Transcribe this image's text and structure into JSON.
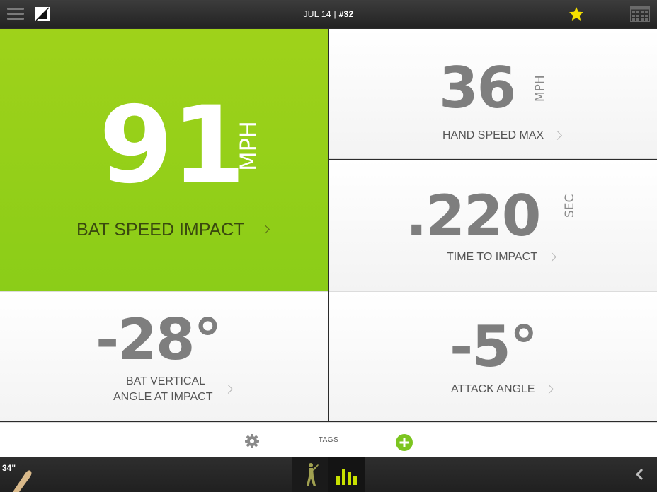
{
  "header": {
    "date": "JUL 14",
    "separator": " | ",
    "swing_number": "#32",
    "icons": [
      "menu-icon",
      "logo-icon",
      "star-icon",
      "calendar-icon"
    ],
    "star_color": "#f5e000"
  },
  "metrics": {
    "bat_speed": {
      "value": "91",
      "unit": "MPH",
      "label": "BAT SPEED IMPACT",
      "highlight_color": "#93cf18"
    },
    "hand_speed": {
      "value": "36",
      "unit": "MPH",
      "label": "HAND SPEED MAX"
    },
    "time_to_impact": {
      "value": ".220",
      "unit": "SEC",
      "label": "TIME TO IMPACT"
    },
    "vertical_angle": {
      "value": "-28°",
      "label_line1": "BAT VERTICAL",
      "label_line2": "ANGLE AT IMPACT"
    },
    "attack_angle": {
      "value": "-5°",
      "label": "ATTACK ANGLE"
    }
  },
  "tags_bar": {
    "label": "TAGS",
    "icons": [
      "gear-icon",
      "add-icon"
    ],
    "add_color": "#7cc520"
  },
  "footer": {
    "bat_size": "34\"",
    "tabs": [
      "swing-tab",
      "stats-tab"
    ],
    "icons": [
      "bat-icon",
      "golfer-icon",
      "bar-chart-icon",
      "back-icon"
    ],
    "active_color": "#c8e000"
  }
}
